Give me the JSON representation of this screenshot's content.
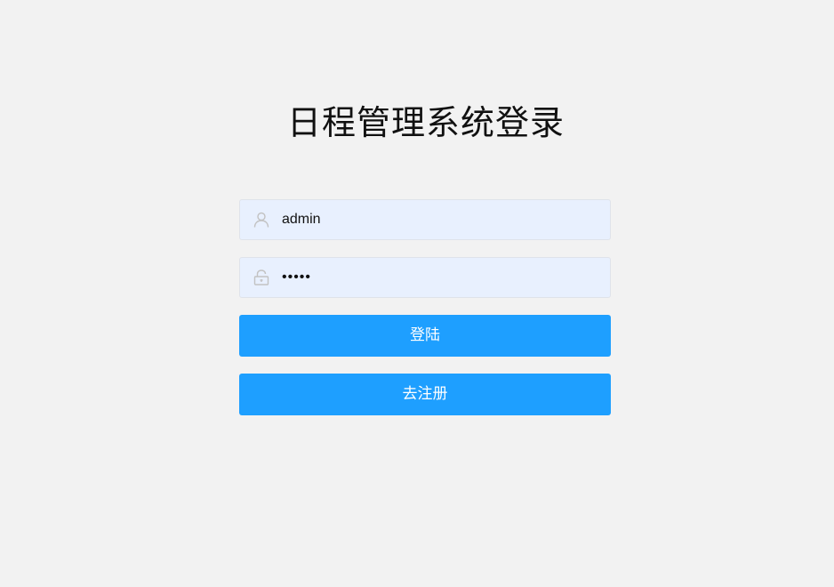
{
  "header": {
    "title": "日程管理系统登录"
  },
  "form": {
    "username": {
      "value": "admin",
      "icon": "user-icon"
    },
    "password": {
      "value": "•••••",
      "icon": "unlock-icon"
    },
    "login_label": "登陆",
    "register_label": "去注册"
  },
  "colors": {
    "background": "#f2f2f2",
    "input_background": "#e8f0fe",
    "button": "#1e9fff",
    "icon": "#c2c2c2"
  }
}
